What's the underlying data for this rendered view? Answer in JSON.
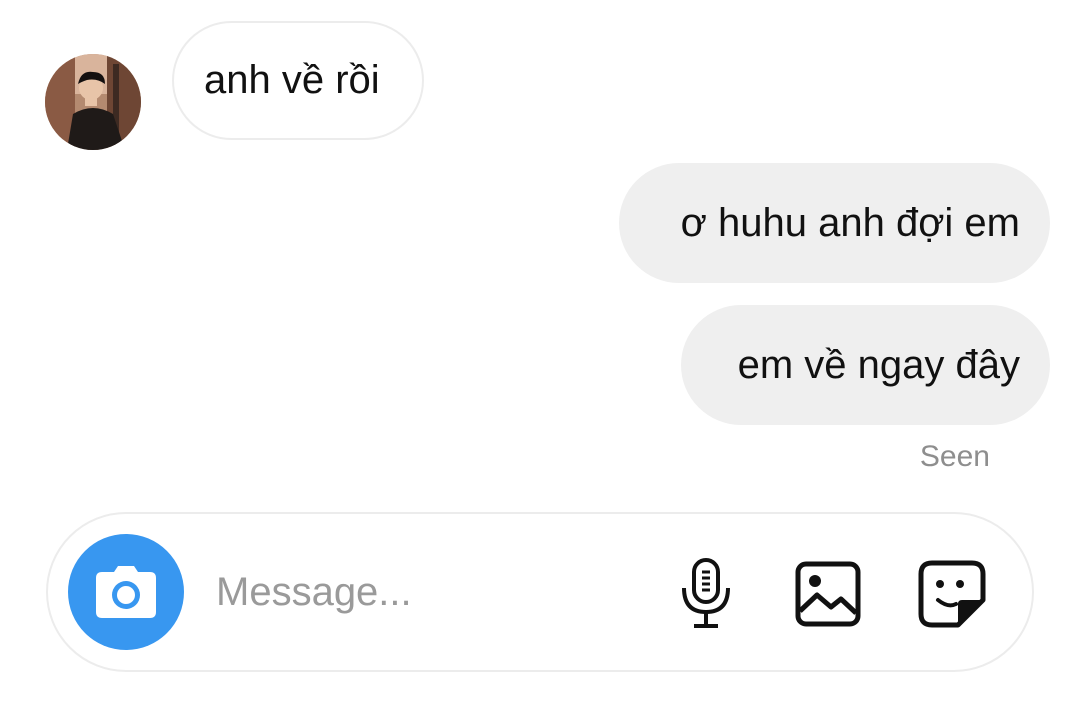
{
  "thread": {
    "incoming": [
      {
        "text": "anh về rồi"
      }
    ],
    "outgoing": [
      {
        "text": "ơ huhu anh đợi em"
      },
      {
        "text": "em về ngay đây"
      }
    ],
    "status": "Seen"
  },
  "composer": {
    "placeholder": "Message...",
    "value": "",
    "icons": {
      "camera": "camera-icon",
      "mic": "microphone-icon",
      "gallery": "gallery-icon",
      "sticker": "sticker-icon"
    }
  },
  "colors": {
    "accent": "#3897f0",
    "outgoing_bubble": "#efefef",
    "incoming_border": "#ececec",
    "status_text": "#8e8e8e",
    "placeholder": "#9a9a9a"
  }
}
